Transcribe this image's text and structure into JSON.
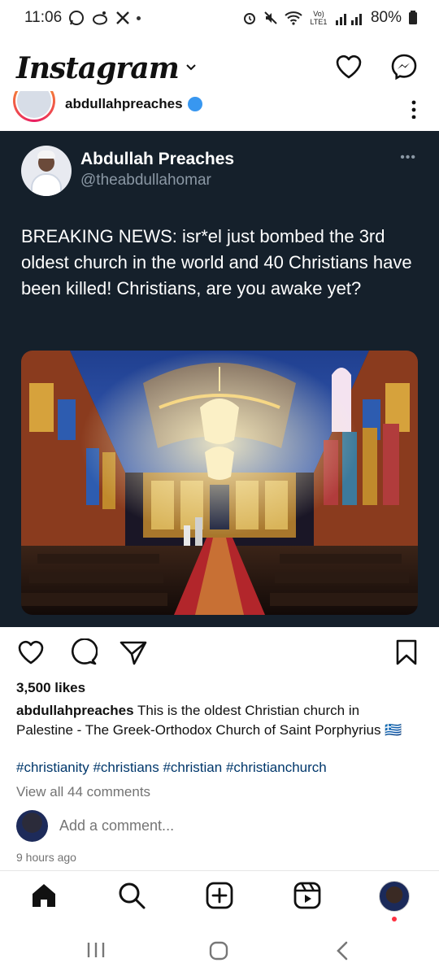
{
  "status_bar": {
    "time": "11:06",
    "network": "Vo) LTE1",
    "battery": "80%"
  },
  "header": {
    "logo": "Instagram"
  },
  "post": {
    "username": "abdullahpreaches",
    "tweet": {
      "name": "Abdullah Preaches",
      "handle": "@theabdullahomar",
      "text": "BREAKING NEWS: isr*el just bombed the 3rd oldest church in the world and 40 Christians have been killed! Christians, are you awake yet?"
    },
    "likes": "3,500 likes",
    "caption_user": "abdullahpreaches",
    "caption_text": "This is the oldest Christian church in Palestine - The Greek-Orthodox Church of Saint Porphyrius 🇬🇷",
    "hashtags": "#christianity #christians #christian #christianchurch",
    "view_comments": "View all 44 comments",
    "add_comment_placeholder": "Add a comment...",
    "time_ago": "9 hours ago"
  },
  "icons": {
    "header": [
      "chevron-down-icon",
      "heart-icon",
      "messenger-icon"
    ],
    "actions": [
      "heart-icon",
      "comment-icon",
      "share-icon",
      "bookmark-icon"
    ],
    "bottom_nav": [
      "home-icon",
      "search-icon",
      "create-icon",
      "reels-icon",
      "profile-avatar"
    ],
    "system_nav": [
      "recents-icon",
      "home-circle-icon",
      "back-icon"
    ]
  },
  "colors": {
    "tweet_background": "#15202b",
    "tweet_handle": "#8b98a5",
    "hashtag": "#00376b",
    "muted": "#737373",
    "notification": "#ff3040"
  }
}
